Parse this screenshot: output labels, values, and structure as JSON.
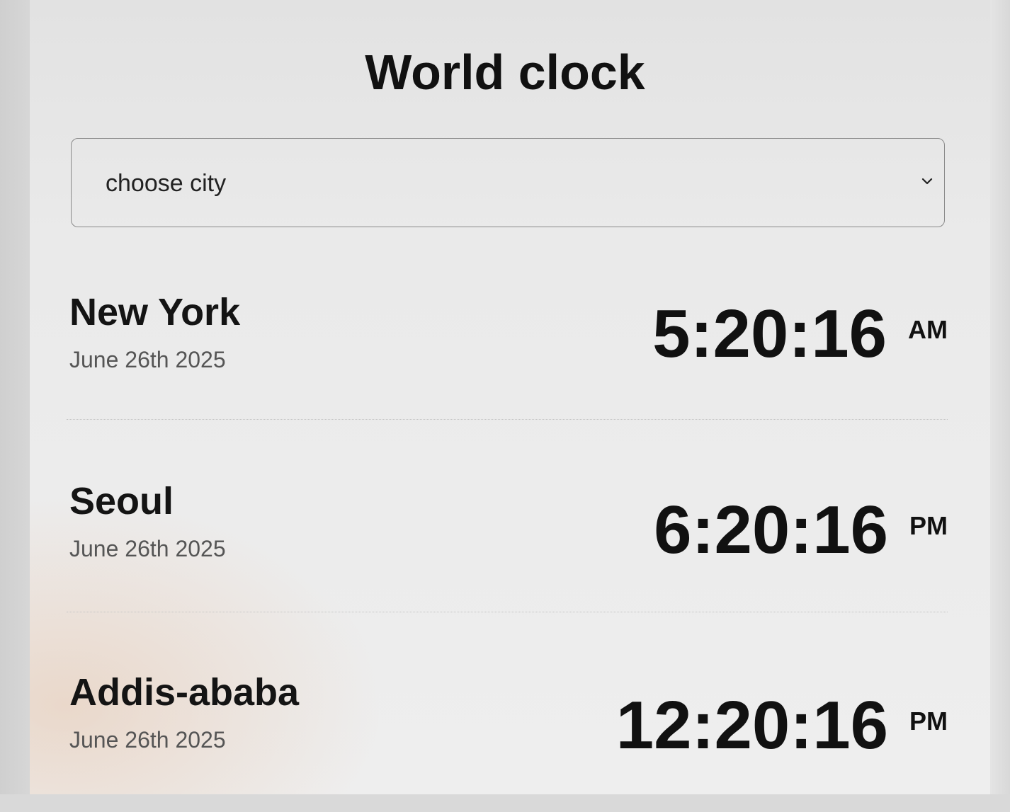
{
  "header": {
    "title": "World clock"
  },
  "city_select": {
    "selected_label": "choose city",
    "icon": "chevron-down-icon"
  },
  "clocks": [
    {
      "city": "New York",
      "date": "June 26th 2025",
      "time": "5:20:16",
      "ampm": "AM"
    },
    {
      "city": "Seoul",
      "date": "June 26th 2025",
      "time": "6:20:16",
      "ampm": "PM"
    },
    {
      "city": "Addis-ababa",
      "date": "June 26th 2025",
      "time": "12:20:16",
      "ampm": "PM"
    }
  ]
}
